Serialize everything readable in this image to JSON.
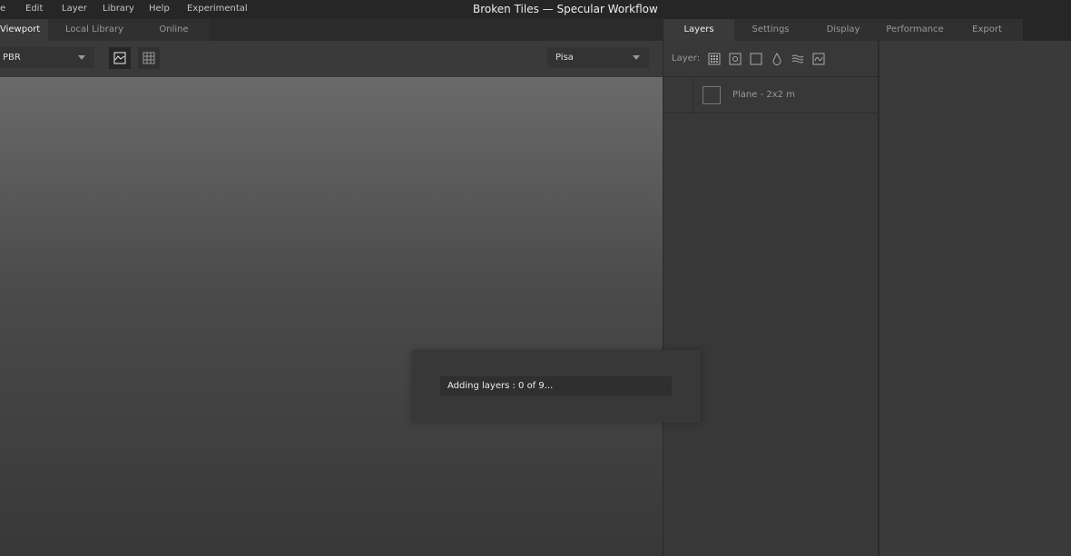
{
  "menu": [
    "e",
    "Edit",
    "Layer",
    "Library",
    "Help",
    "Experimental"
  ],
  "window_title": "Broken Tiles — Specular Workflow",
  "left_tabs": [
    "Viewport",
    "Local Library",
    "Online"
  ],
  "toolbar": {
    "shading_mode": "PBR",
    "environment": "Pisa"
  },
  "right_tabs": [
    "Layers",
    "Settings",
    "Display",
    "Performance",
    "Export"
  ],
  "layers": {
    "label": "Layer:",
    "items": [
      {
        "name": "Plane - 2x2 m"
      }
    ]
  },
  "progress": {
    "text": "Adding layers : 0 of 9...",
    "current": 0,
    "total": 9
  }
}
